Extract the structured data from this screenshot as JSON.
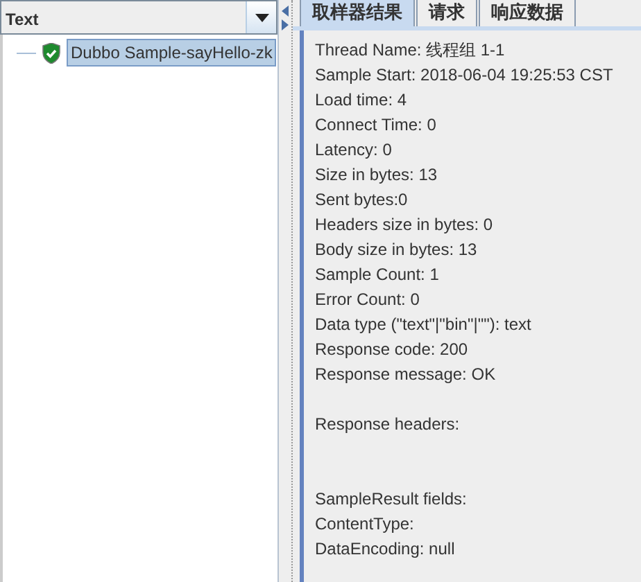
{
  "left_panel": {
    "view_selector": {
      "value": "Text"
    },
    "tree": [
      {
        "label": "Dubbo Sample-sayHello-zk",
        "passed": true,
        "selected": true
      }
    ]
  },
  "tabs": [
    {
      "label": "取样器结果",
      "selected": true
    },
    {
      "label": "请求",
      "selected": false
    },
    {
      "label": "响应数据",
      "selected": false
    }
  ],
  "result_lines": [
    {
      "kind": "line",
      "text": "Thread Name: 线程组 1-1"
    },
    {
      "kind": "line",
      "text": "Sample Start: 2018-06-04 19:25:53 CST"
    },
    {
      "kind": "line",
      "text": "Load time: 4"
    },
    {
      "kind": "line",
      "text": "Connect Time: 0"
    },
    {
      "kind": "line",
      "text": "Latency: 0"
    },
    {
      "kind": "line",
      "text": "Size in bytes: 13"
    },
    {
      "kind": "line",
      "text": "Sent bytes:0"
    },
    {
      "kind": "line",
      "text": "Headers size in bytes: 0"
    },
    {
      "kind": "line",
      "text": "Body size in bytes: 13"
    },
    {
      "kind": "line",
      "text": "Sample Count: 1"
    },
    {
      "kind": "line",
      "text": "Error Count: 0"
    },
    {
      "kind": "line",
      "text": "Data type (\"text\"|\"bin\"|\"\"): text"
    },
    {
      "kind": "line",
      "text": "Response code: 200"
    },
    {
      "kind": "line",
      "text": "Response message: OK"
    },
    {
      "kind": "blank"
    },
    {
      "kind": "line",
      "text": "Response headers:"
    },
    {
      "kind": "blank"
    },
    {
      "kind": "blank"
    },
    {
      "kind": "line",
      "text": "SampleResult fields:"
    },
    {
      "kind": "line",
      "text": "ContentType:"
    },
    {
      "kind": "line",
      "text": "DataEncoding: null"
    }
  ]
}
